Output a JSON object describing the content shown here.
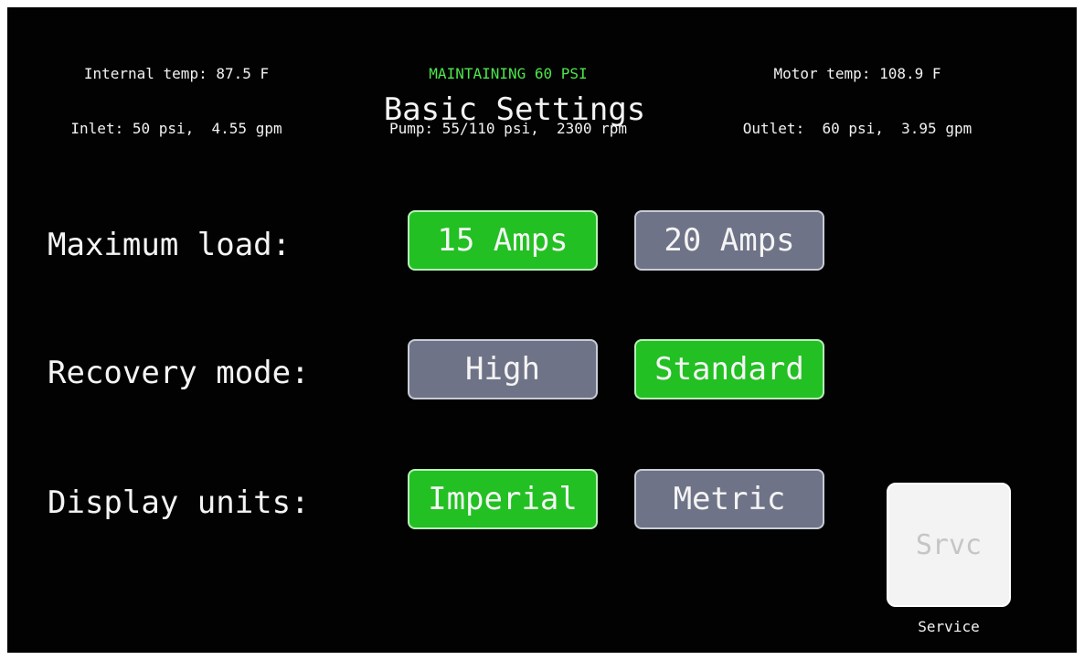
{
  "status": {
    "left": {
      "line1": "Internal temp: 87.5 F",
      "line2": "Inlet: 50 psi,  4.55 gpm"
    },
    "center": {
      "mode": "MAINTAINING 60 PSI",
      "line2": "Pump: 55/110 psi,  2300 rpm"
    },
    "right": {
      "line1": "Motor temp: 108.9 F",
      "line2": "Outlet:  60 psi,  3.95 gpm"
    }
  },
  "title": "Basic Settings",
  "settings": {
    "max_load": {
      "label": "Maximum load:",
      "options": [
        "15 Amps",
        "20 Amps"
      ],
      "selected": "15 Amps"
    },
    "recovery_mode": {
      "label": "Recovery mode:",
      "options": [
        "High",
        "Standard"
      ],
      "selected": "Standard"
    },
    "display_units": {
      "label": "Display units:",
      "options": [
        "Imperial",
        "Metric"
      ],
      "selected": "Imperial"
    }
  },
  "service": {
    "button_label": "Srvc",
    "caption": "Service"
  },
  "colors": {
    "selected": "#22c022",
    "unselected": "#6e7387",
    "status_mode": "#4de64d",
    "background": "#020202"
  }
}
